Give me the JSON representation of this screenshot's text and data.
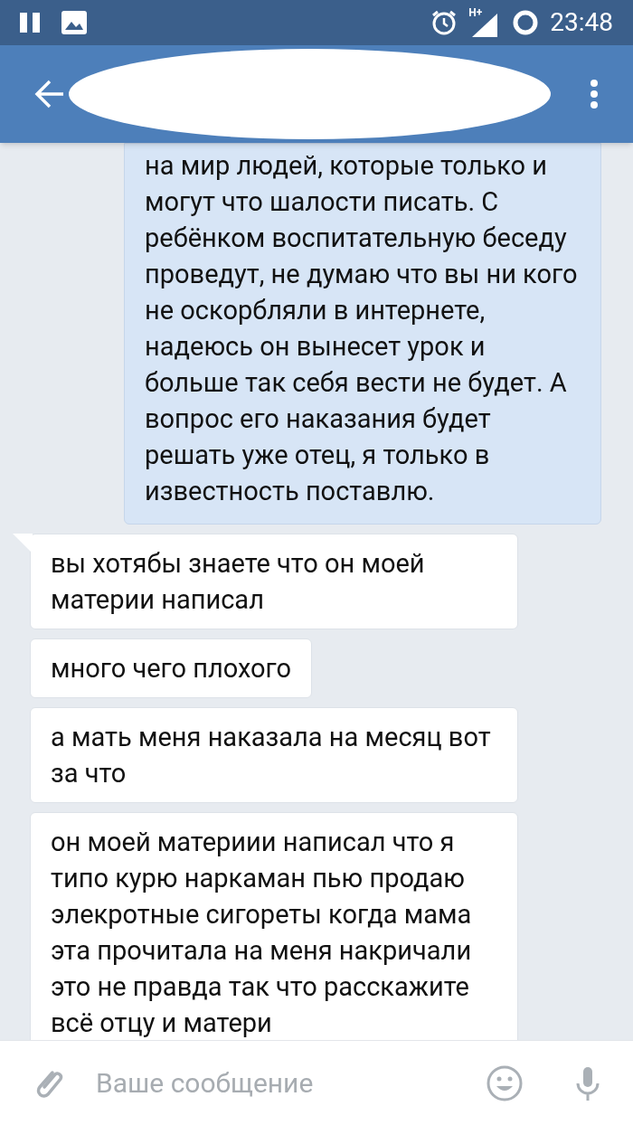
{
  "status_bar": {
    "time": "23:48",
    "network": "H+"
  },
  "header": {
    "redacted": true
  },
  "messages": [
    {
      "kind": "outgoing",
      "text": "на мир людей, которые только и могут что шалости писать. С ребёнком воспитательную беседу проведут, не думаю что вы ни кого не оскорбляли в интернете, надеюсь он вынесет урок и больше так себя вести не будет. А вопрос его наказания будет решать уже отец, я только в известность поставлю."
    },
    {
      "kind": "incoming",
      "first": true,
      "text": "вы хотябы знаете что он моей материи написал"
    },
    {
      "kind": "incoming",
      "first": false,
      "text": "много чего плохого"
    },
    {
      "kind": "incoming",
      "first": false,
      "text": "а мать меня наказала на месяц вот за что"
    },
    {
      "kind": "incoming",
      "first": false,
      "text": "он моей материии написал что я типо курю наркаман пью продаю элекротные сигореты когда мама эта прочитала на меня накричали это не правда так что расскажите всё отцу и матери"
    }
  ],
  "composer": {
    "placeholder": "Ваше сообщение"
  }
}
